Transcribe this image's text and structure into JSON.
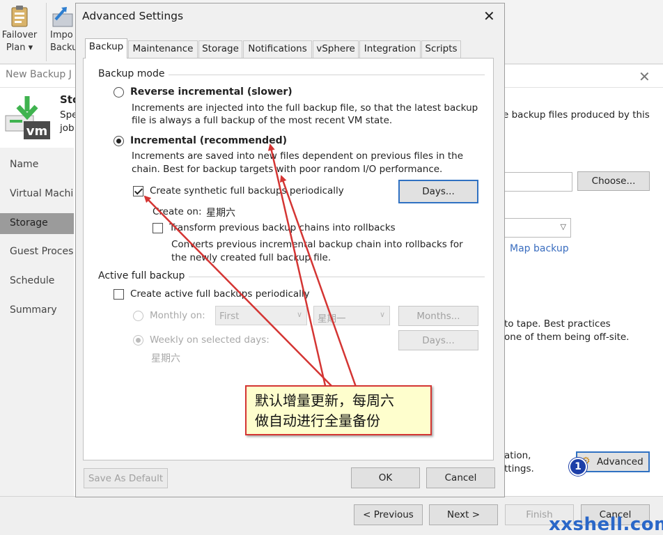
{
  "ribbon": {
    "failover_line1": "Failover",
    "failover_line2": "Plan ▾",
    "import_line1": "Impo",
    "import_line2": "Backu"
  },
  "wizard": {
    "title": "New Backup J",
    "header_title": "Sto",
    "header_sub1": "Spe",
    "header_sub2": "job",
    "header_desc": "e backup files produced by this",
    "logo_text": "vm",
    "nav": [
      "Name",
      "Virtual Machi",
      "Storage",
      "Guest Process",
      "Schedule",
      "Summary"
    ],
    "choose_label": "Choose...",
    "map_backup_label": "Map backup",
    "tape_line1": "to tape. Best practices",
    "tape_line2": "one of them being off-site.",
    "adv_line1": "ation,",
    "adv_line2": "ttings.",
    "advanced_label": "Advanced",
    "badge": "1",
    "prev_label": "< Previous",
    "next_label": "Next >",
    "finish_label": "Finish",
    "cancel_label": "Cancel"
  },
  "dialog": {
    "title": "Advanced Settings",
    "tabs": [
      "Backup",
      "Maintenance",
      "Storage",
      "Notifications",
      "vSphere",
      "Integration",
      "Scripts"
    ],
    "backup_mode_label": "Backup mode",
    "reverse_label": "Reverse incremental (slower)",
    "reverse_desc1": "Increments are injected into the full backup file, so that the latest backup",
    "reverse_desc2": "file is always a full backup of the most recent VM state.",
    "incremental_label": "Incremental (recommended)",
    "incremental_desc1": "Increments are saved into new files dependent on previous files in the",
    "incremental_desc2": "chain. Best for backup targets with poor random I/O performance.",
    "synthetic_label": "Create synthetic full backups periodically",
    "days_label": "Days...",
    "create_on_label": "Create on:",
    "create_on_value": "星期六",
    "transform_label": "Transform previous backup chains into rollbacks",
    "transform_desc1": "Converts previous incremental backup chain into rollbacks for",
    "transform_desc2": "the newly created full backup file.",
    "active_full_label": "Active full backup",
    "active_check_label": "Create active full backups periodically",
    "monthly_label": "Monthly on:",
    "monthly_first": "First",
    "monthly_day": "星期一",
    "months_label": "Months...",
    "weekly_label": "Weekly on selected days:",
    "weekly_value": "星期六",
    "days2_label": "Days...",
    "save_default_label": "Save As Default",
    "ok_label": "OK",
    "cancel_label": "Cancel"
  },
  "annotation": {
    "line1": "默认增量更新，每周六",
    "line2": "做自动进行全量备份"
  },
  "watermark": "xxshell.com",
  "colors": {
    "callout_border": "#d43533",
    "callout_fill": "#fefecd",
    "badge": "#1d3fa8",
    "focus": "#2f71c2",
    "veeam_green": "#3fb34f"
  }
}
